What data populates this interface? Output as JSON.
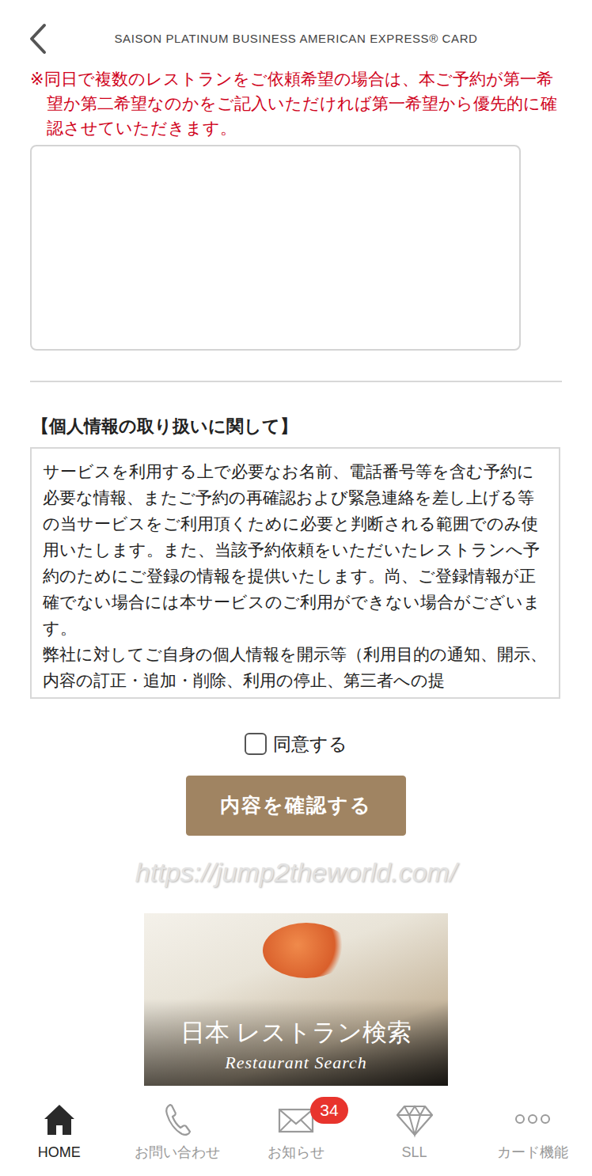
{
  "header": {
    "title": "SAISON PLATINUM BUSINESS AMERICAN EXPRESS® CARD"
  },
  "request": {
    "note": "※同日で複数のレストランをご依頼希望の場合は、本ご予約が第一希望か第二希望なのかをご記入いただければ第一希望から優先的に確認させていただきます。"
  },
  "privacy": {
    "heading": "【個人情報の取り扱いに関して】",
    "paragraphs": [
      "サービスを利用する上で必要なお名前、電話番号等を含む予約に必要な情報、またご予約の再確認および緊急連絡を差し上げる等の当サービスをご利用頂くために必要と判断される範囲でのみ使用いたします。また、当該予約依頼をいただいたレストランへ予約のためにご登録の情報を提供いたします。尚、ご登録情報が正確でない場合には本サービスのご利用ができない場合がございます。",
      "弊社に対してご自身の個人情報を開示等（利用目的の通知、開示、内容の訂正・追加・削除、利用の停止、第三者への提"
    ]
  },
  "consent": {
    "label": "同意する",
    "checked": false
  },
  "confirm_button": "内容を確認する",
  "watermark": "https://jump2theworld.com/",
  "banner": {
    "title": "日本 レストラン検索",
    "subtitle": "Restaurant Search"
  },
  "tab_bar": [
    {
      "label": "HOME",
      "selected": true
    },
    {
      "label": "お問い合わせ",
      "selected": false
    },
    {
      "label": "お知らせ",
      "selected": false,
      "badge": "34"
    },
    {
      "label": "SLL",
      "selected": false
    },
    {
      "label": "カード機能",
      "selected": false
    }
  ]
}
